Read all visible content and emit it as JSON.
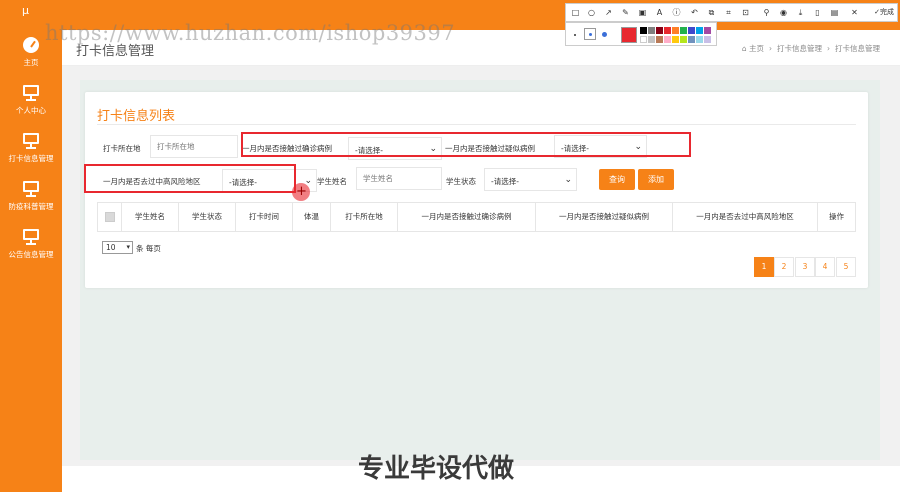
{
  "sidebar": {
    "logo": "µ",
    "items": [
      {
        "label": "主页",
        "icon": "dashboard-icon"
      },
      {
        "label": "个人中心",
        "icon": "monitor-icon"
      },
      {
        "label": "打卡信息管理",
        "icon": "monitor-icon"
      },
      {
        "label": "防疫科普管理",
        "icon": "monitor-icon"
      },
      {
        "label": "公告信息管理",
        "icon": "monitor-icon"
      }
    ]
  },
  "header": {
    "page_title": "打卡信息管理",
    "breadcrumb": [
      "主页",
      "打卡信息管理",
      "打卡信息管理"
    ]
  },
  "card": {
    "title": "打卡信息列表"
  },
  "filters": {
    "location_label": "打卡所在地",
    "location_placeholder": "打卡所在地",
    "confirmed_label": "一月内是否接触过确诊病例",
    "confirmed_value": "-请选择-",
    "suspected_label": "一月内是否接触过疑似病例",
    "suspected_value": "-请选择-",
    "risk_label": "一月内是否去过中高风险地区",
    "risk_value": "-请选择-",
    "name_label": "学生姓名",
    "name_placeholder": "学生姓名",
    "status_label": "学生状态",
    "status_value": "-请选择-",
    "search_button": "查询",
    "add_button": "添加"
  },
  "table": {
    "columns": [
      "学生姓名",
      "学生状态",
      "打卡时间",
      "体温",
      "打卡所在地",
      "一月内是否接触过确诊病例",
      "一月内是否接触过疑似病例",
      "一月内是否去过中高风险地区",
      "操作"
    ]
  },
  "pagination": {
    "page_size": "10",
    "page_size_suffix": "条 每页",
    "pages": [
      "1",
      "2",
      "3",
      "4",
      "5"
    ],
    "active_page": "1"
  },
  "snip_toolbar": {
    "done_label": "完成",
    "current_color": "#e8282f"
  },
  "watermark": {
    "url": "https://www.huzhan.com/ishop39397",
    "bottom_text": "专业毕设代做"
  },
  "colors": {
    "accent": "#f68217",
    "highlight": "#e8282f"
  }
}
